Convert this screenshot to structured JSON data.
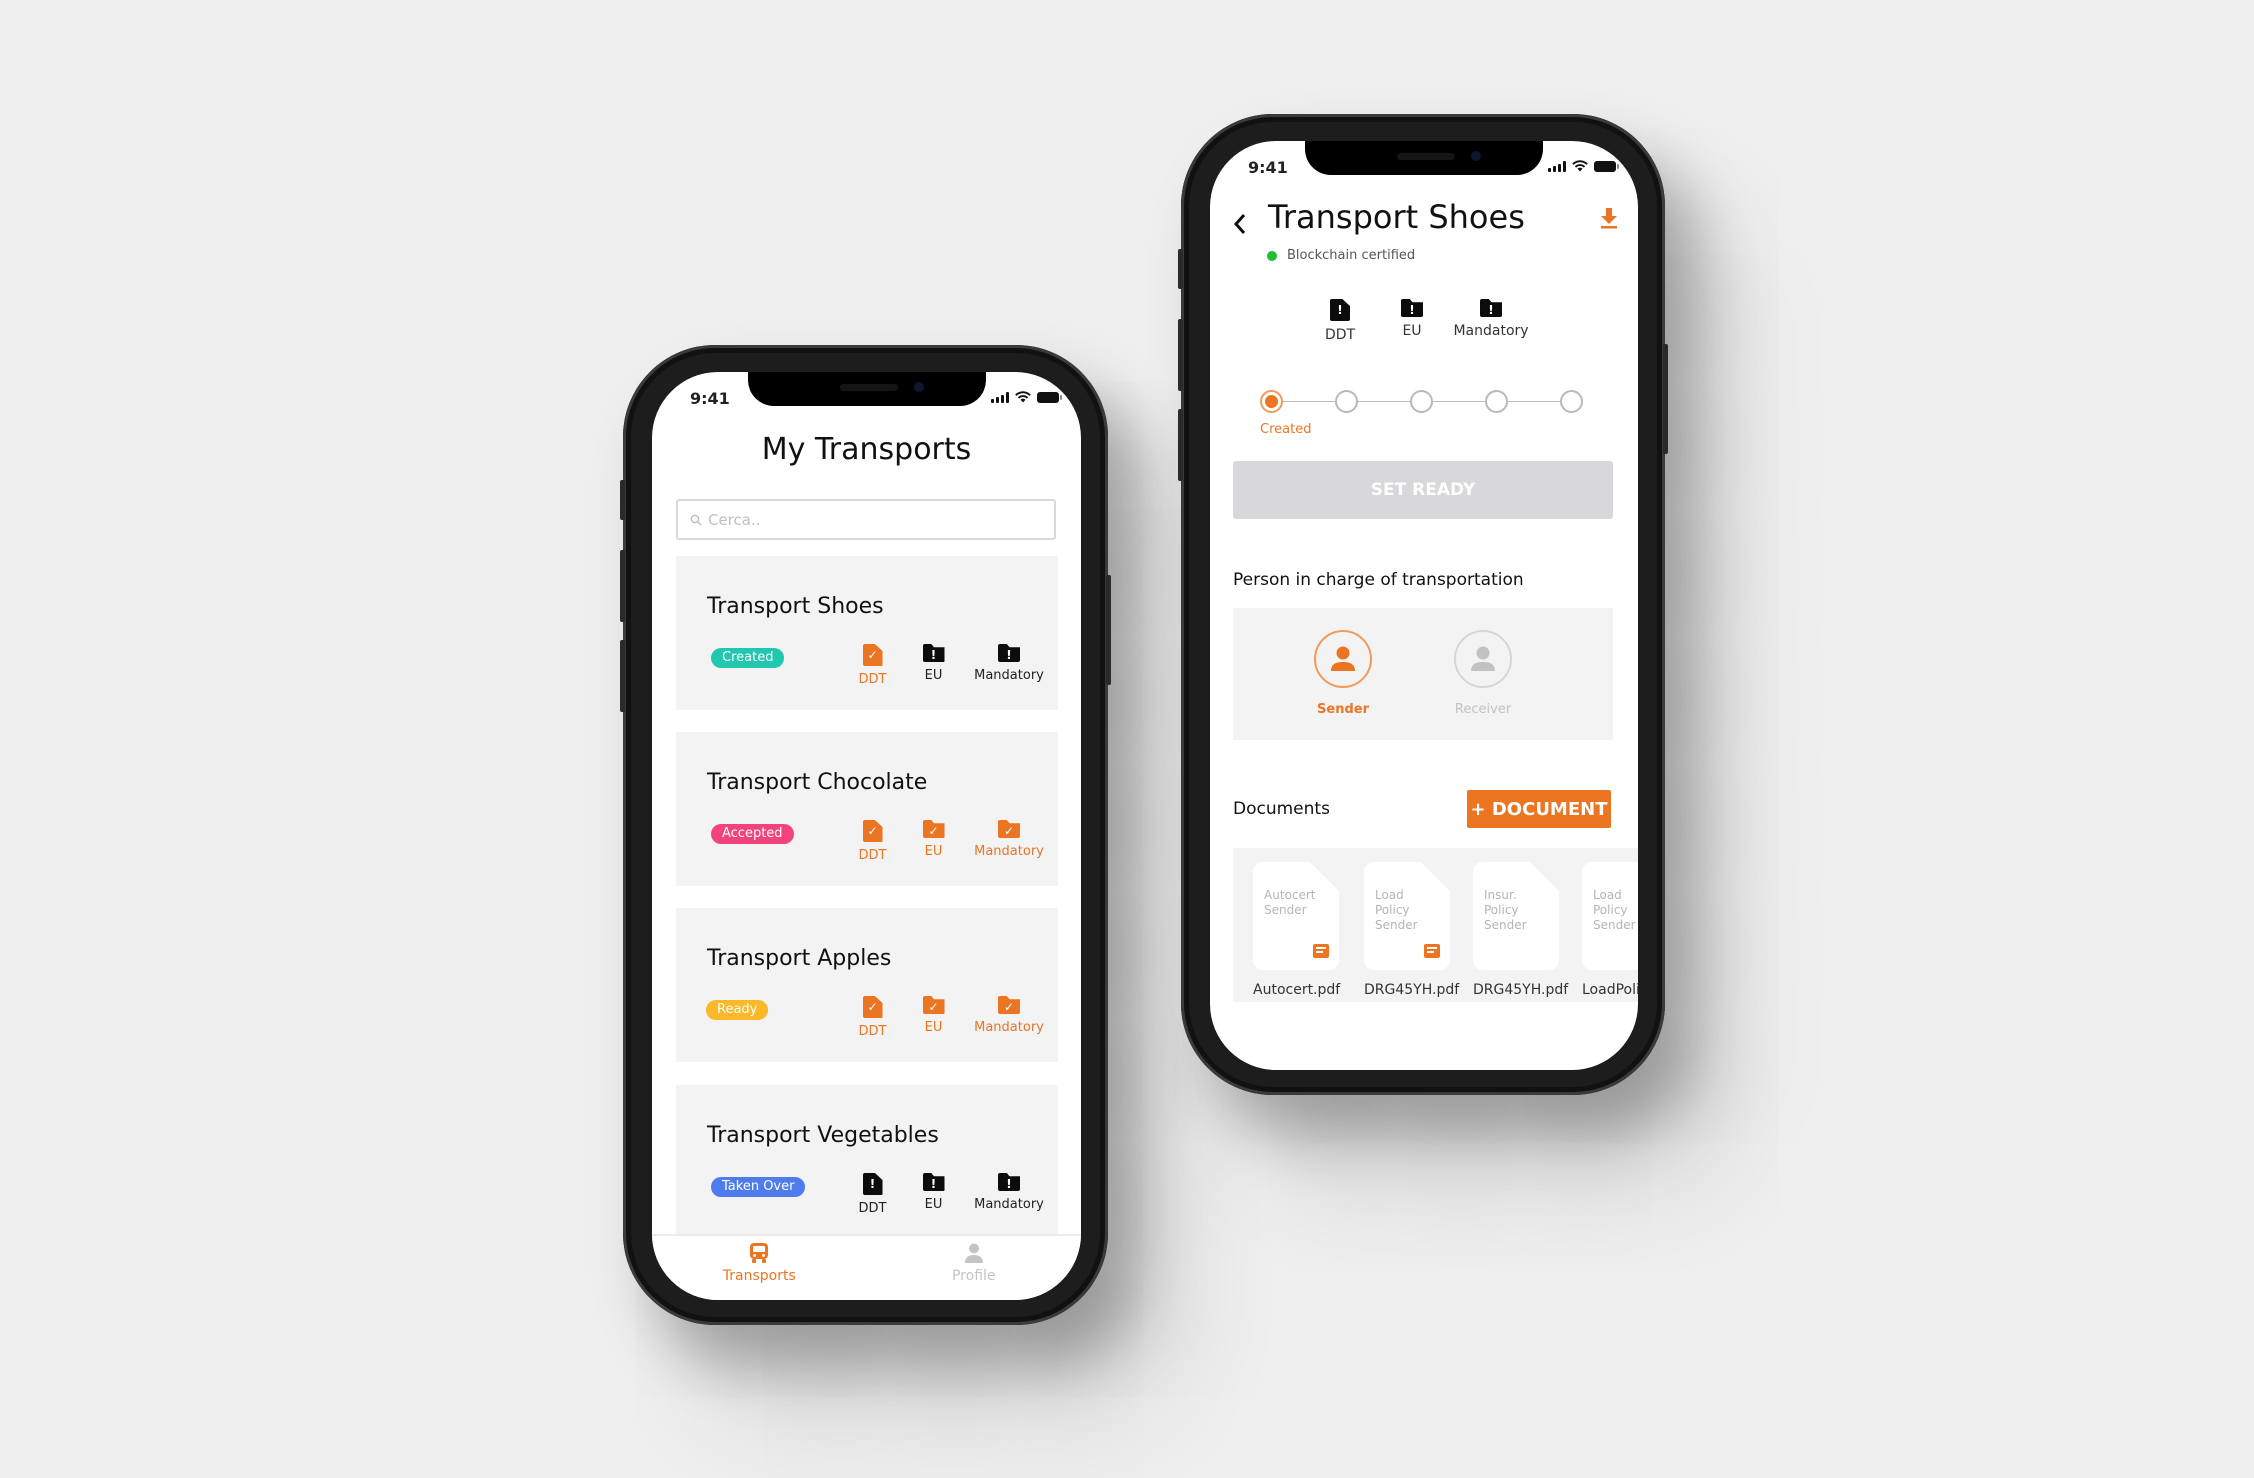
{
  "status_bar": {
    "time": "9:41"
  },
  "colors": {
    "accent": "#ec7524",
    "background": "#efefef",
    "card": "#f3f3f3",
    "status_created": "#22c7b0",
    "status_accepted": "#f2437b",
    "status_ready": "#fbb829",
    "status_taken_over": "#4f7cec",
    "certified_dot": "#1fbf2d",
    "disabled_button": "#d8d8da"
  },
  "list_screen": {
    "title": "My Transports",
    "search": {
      "placeholder": "Cerca..",
      "value": "",
      "icon": "search-icon"
    },
    "transports": [
      {
        "name": "Transport Shoes",
        "status": "Created",
        "status_color": "#22c7b0",
        "docs": [
          {
            "label": "DDT",
            "state": "ok",
            "icon": "file-check-icon"
          },
          {
            "label": "EU",
            "state": "missing",
            "icon": "folder-alert-icon"
          },
          {
            "label": "Mandatory",
            "state": "missing",
            "icon": "folder-alert-icon"
          }
        ]
      },
      {
        "name": "Transport Chocolate",
        "status": "Accepted",
        "status_color": "#f2437b",
        "docs": [
          {
            "label": "DDT",
            "state": "ok",
            "icon": "file-check-icon"
          },
          {
            "label": "EU",
            "state": "ok",
            "icon": "folder-check-icon"
          },
          {
            "label": "Mandatory",
            "state": "ok",
            "icon": "folder-check-icon"
          }
        ]
      },
      {
        "name": "Transport Apples",
        "status": "Ready",
        "status_color": "#fbb829",
        "docs": [
          {
            "label": "DDT",
            "state": "ok",
            "icon": "file-check-icon"
          },
          {
            "label": "EU",
            "state": "ok",
            "icon": "folder-check-icon"
          },
          {
            "label": "Mandatory",
            "state": "ok",
            "icon": "folder-check-icon"
          }
        ]
      },
      {
        "name": "Transport Vegetables",
        "status": "Taken Over",
        "status_color": "#4f7cec",
        "docs": [
          {
            "label": "DDT",
            "state": "missing",
            "icon": "file-alert-icon"
          },
          {
            "label": "EU",
            "state": "missing",
            "icon": "folder-alert-icon"
          },
          {
            "label": "Mandatory",
            "state": "missing",
            "icon": "folder-alert-icon"
          }
        ]
      }
    ],
    "tab_bar": [
      {
        "label": "Transports",
        "icon": "bus-icon",
        "active": true
      },
      {
        "label": "Profile",
        "icon": "person-icon",
        "active": false
      }
    ]
  },
  "detail_screen": {
    "title": "Transport Shoes",
    "back_icon": "chevron-left-icon",
    "download_icon": "download-icon",
    "certification": "Blockchain certified",
    "docs": [
      {
        "label": "DDT",
        "icon": "file-alert-icon"
      },
      {
        "label": "EU",
        "icon": "folder-alert-icon"
      },
      {
        "label": "Mandatory",
        "icon": "folder-alert-icon"
      }
    ],
    "stepper": {
      "total_steps": 5,
      "current_step": 1,
      "current_label": "Created"
    },
    "set_ready_label": "SET READY",
    "person_section_title": "Person in charge of transportation",
    "persons": [
      {
        "label": "Sender",
        "selected": true
      },
      {
        "label": "Receiver",
        "selected": false
      }
    ],
    "documents_title": "Documents",
    "add_document_label": "+ DOCUMENT",
    "documents": [
      {
        "type": "Autocert",
        "owner": "Sender",
        "filename": "Autocert.pdf",
        "has_comment": true
      },
      {
        "type": "Load Policy",
        "owner": "Sender",
        "filename": "DRG45YH.pdf",
        "has_comment": true
      },
      {
        "type": "Insur. Policy",
        "owner": "Sender",
        "filename": "DRG45YH.pdf",
        "has_comment": false
      },
      {
        "type": "Load Policy",
        "owner": "Sender",
        "filename": "LoadPolicy.pdf",
        "has_comment": false
      }
    ]
  }
}
